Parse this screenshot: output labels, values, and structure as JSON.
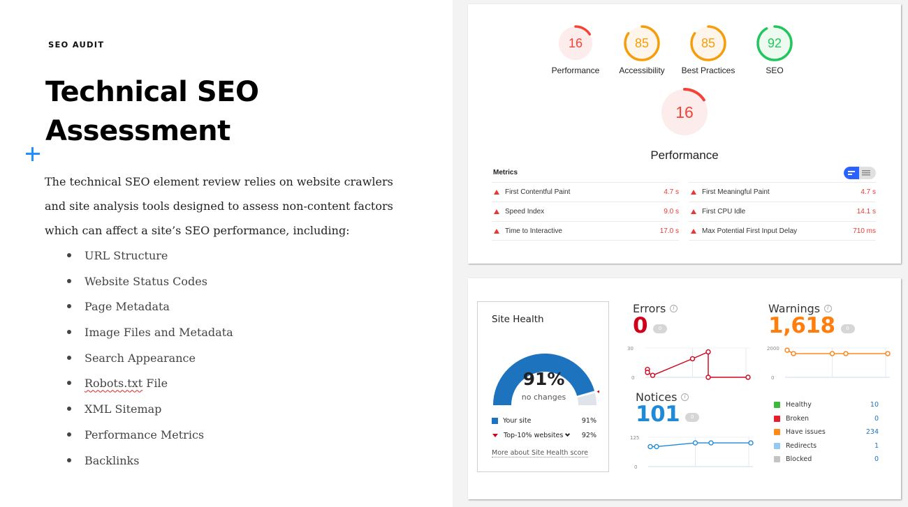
{
  "slide": {
    "eyebrow": "SEO AUDIT",
    "title_line1": "Technical SEO",
    "title_line2": "Assessment",
    "intro": "The technical SEO element review relies on website crawlers and site analysis tools designed to assess non-content factors which can affect a site’s SEO performance, including:",
    "bullets": [
      "URL Structure",
      "Website Status Codes",
      "Page Metadata",
      "Image Files and Metadata",
      "Search Appearance",
      "Robots.txt",
      "XML Sitemap",
      "Performance Metrics",
      "Backlinks"
    ],
    "bullet_6_suffix": " File",
    "plus_icon_color": "#1e90ff"
  },
  "lighthouse": {
    "scores": [
      {
        "label": "Performance",
        "value": 16,
        "color": "#f44336",
        "bg": "#fdecec"
      },
      {
        "label": "Accessibility",
        "value": 85,
        "color": "#f59e0b",
        "bg": "#fff5eb"
      },
      {
        "label": "Best Practices",
        "value": 85,
        "color": "#f59e0b",
        "bg": "#fff5eb"
      },
      {
        "label": "SEO",
        "value": 92,
        "color": "#22c55e",
        "bg": "#ecfaef"
      }
    ],
    "focus": {
      "label": "Performance",
      "value": 16,
      "color": "#f44336",
      "bg": "#fdecec"
    },
    "metrics_title": "Metrics",
    "metrics_left": [
      {
        "name": "First Contentful Paint",
        "value": "4.7 s"
      },
      {
        "name": "Speed Index",
        "value": "9.0 s"
      },
      {
        "name": "Time to Interactive",
        "value": "17.0 s"
      }
    ],
    "metrics_right": [
      {
        "name": "First Meaningful Paint",
        "value": "4.7 s"
      },
      {
        "name": "First CPU Idle",
        "value": "14.1 s"
      },
      {
        "name": "Max Potential First Input Delay",
        "value": "710 ms"
      }
    ],
    "toggle_active": "condensed"
  },
  "site_health": {
    "title": "Site Health",
    "percent": "91%",
    "percent_value": 91,
    "top10_value": 92,
    "subtitle": "no changes",
    "legend": [
      {
        "label": "Your site",
        "value": "91%"
      },
      {
        "label": "Top-10% websites",
        "value": "92%"
      }
    ],
    "link": "More about Site Health score",
    "color": "#1e73be"
  },
  "errors": {
    "title": "Errors",
    "value": "0",
    "badge": "0",
    "color": "#d0021b",
    "chart": {
      "ymax_label": "30",
      "ymin_label": "0",
      "ymax": 30,
      "points": [
        [
          0.02,
          8
        ],
        [
          0.02,
          5
        ],
        [
          0.07,
          2
        ],
        [
          0.45,
          19
        ],
        [
          0.6,
          26
        ],
        [
          0.6,
          0
        ],
        [
          0.98,
          0
        ]
      ]
    }
  },
  "warnings": {
    "title": "Warnings",
    "value": "1,618",
    "badge": "0",
    "color": "#ff7f0e",
    "chart": {
      "ymax_label": "2000",
      "ymin_label": "0",
      "ymax": 2000,
      "points": [
        [
          0.02,
          1850
        ],
        [
          0.08,
          1618
        ],
        [
          0.45,
          1618
        ],
        [
          0.58,
          1618
        ],
        [
          0.98,
          1618
        ]
      ]
    }
  },
  "notices": {
    "title": "Notices",
    "value": "101",
    "badge": "0",
    "color": "#1f8ad8",
    "chart": {
      "ymax_label": "125",
      "ymin_label": "0",
      "ymax": 125,
      "points": [
        [
          0.02,
          85
        ],
        [
          0.08,
          85
        ],
        [
          0.45,
          101
        ],
        [
          0.6,
          101
        ],
        [
          0.98,
          101
        ]
      ]
    }
  },
  "crawled_pages": [
    {
      "label": "Healthy",
      "value": "10",
      "color": "#3cb83c"
    },
    {
      "label": "Broken",
      "value": "0",
      "color": "#e5202e"
    },
    {
      "label": "Have issues",
      "value": "234",
      "color": "#ff8c1a"
    },
    {
      "label": "Redirects",
      "value": "1",
      "color": "#94c9f0"
    },
    {
      "label": "Blocked",
      "value": "0",
      "color": "#c4c4c4"
    }
  ]
}
